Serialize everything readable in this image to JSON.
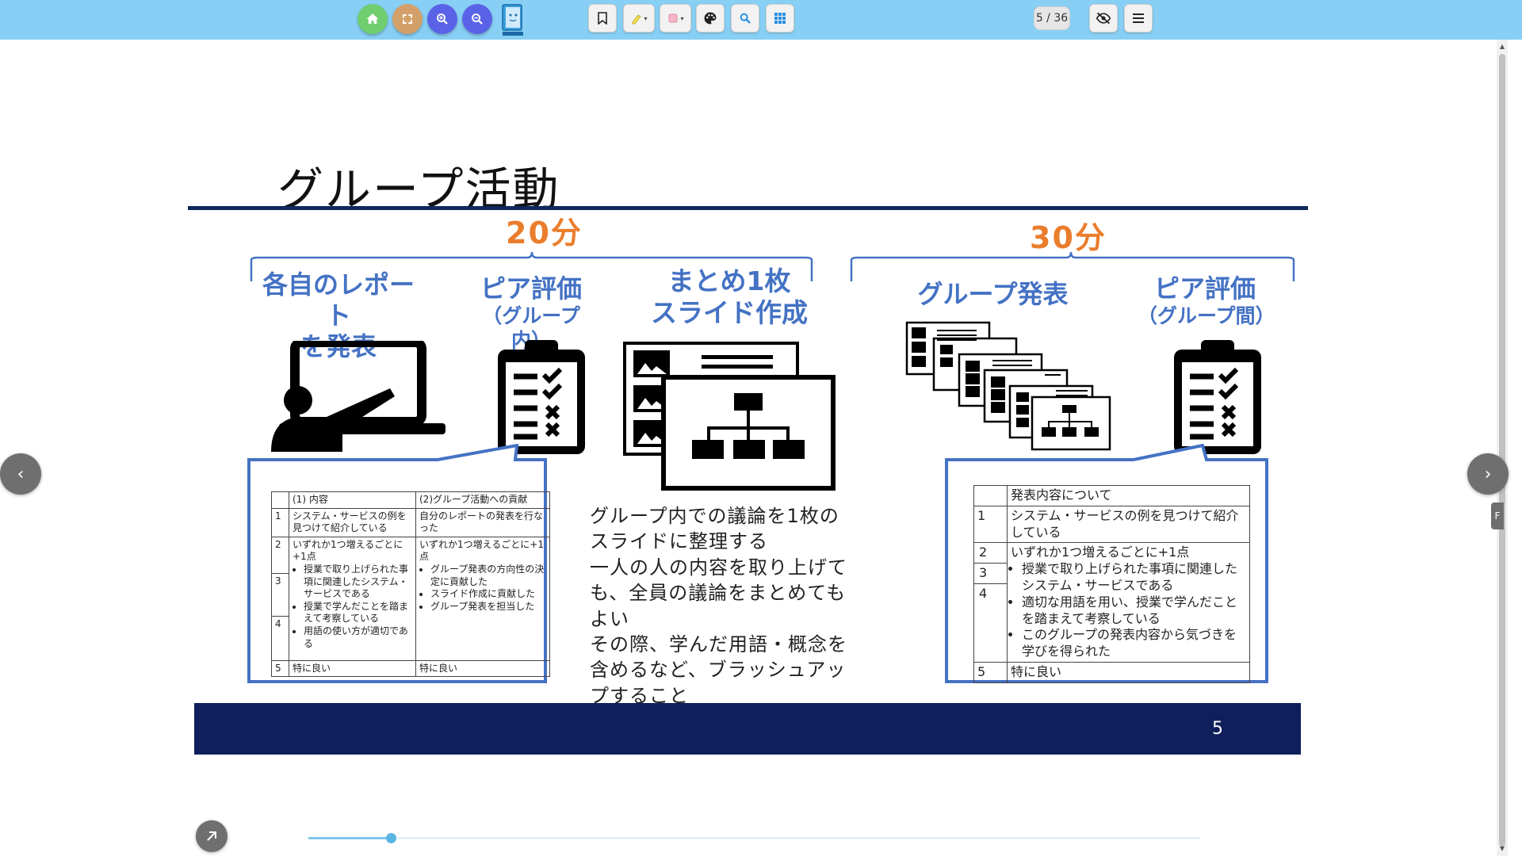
{
  "toolbar": {
    "page_indicator": "5 / 36",
    "colors": {
      "bar": "#87cff4",
      "home": "#6fcf6f",
      "fullscreen": "#d4a06a",
      "zoom": "#5a63e8"
    },
    "left_buttons": [
      "home-icon",
      "fullscreen-icon",
      "zoom-in-icon",
      "zoom-out-icon"
    ],
    "tool_buttons": [
      "bookmark-icon",
      "highlighter-icon",
      "eraser-icon",
      "palette-icon",
      "search-icon",
      "grid-icon"
    ],
    "right_buttons": [
      "hide-icon",
      "menu-icon"
    ]
  },
  "slide": {
    "title": "グループ活動",
    "time1": "20分",
    "time2": "30分",
    "step1": [
      "各自のレポート",
      "を発表"
    ],
    "step2": "ピア評価",
    "step2_sub": "（グループ内）",
    "step3": [
      "まとめ1枚",
      "スライド作成"
    ],
    "step4": "グループ発表",
    "step5": "ピア評価",
    "step5_sub": "（グループ間）",
    "paragraph": [
      "グループ内での議論を1枚の",
      "スライドに整理する",
      "一人の人の内容を取り上げて",
      "も、全員の議論をまとめても",
      "よい",
      "その際、学んだ用語・概念を",
      "含めるなど、ブラッシュアッ",
      "プすること"
    ],
    "page_number": "5",
    "rubric_left": {
      "header": [
        "",
        "(1) 内容",
        "(2)グループ活動への貢献"
      ],
      "r1": {
        "n": "1",
        "a": "システム・サービスの例を見つけて紹介している",
        "b": "自分のレポートの発表を行なった"
      },
      "r2": {
        "n": [
          "2",
          "3",
          "4"
        ],
        "a_intro": "いずれか1つ増えるごとに+1点",
        "a_items": [
          "授業で取り上げられた事項に関連したシステム・サービスである",
          "授業で学んだことを踏まえて考察している",
          "用語の使い方が適切である"
        ],
        "b_intro": "いずれか1つ増えるごとに+1点",
        "b_items": [
          "グループ発表の方向性の決定に貢献した",
          "スライド作成に貢献した",
          "グループ発表を担当した"
        ]
      },
      "r5": {
        "n": "5",
        "a": "特に良い",
        "b": "特に良い"
      }
    },
    "rubric_right": {
      "header": [
        "",
        "発表内容について"
      ],
      "r1": {
        "n": "1",
        "a": "システム・サービスの例を見つけて紹介している"
      },
      "r2": {
        "n": [
          "2",
          "3",
          "4"
        ],
        "a_intro": "いずれか1つ増えるごとに+1点",
        "a_items": [
          "授業で取り上げられた事項に関連したシステム・サービスである",
          "適切な用語を用い、授業で学んだことを踏まえて考察している",
          "このグループの発表内容から気づきを学びを得られた"
        ]
      },
      "r5": {
        "n": "5",
        "a": "特に良い"
      }
    }
  },
  "nav": {
    "prev": "‹",
    "next": "›",
    "side_tab": "F"
  },
  "progress": {
    "current_fraction": 0.092
  }
}
